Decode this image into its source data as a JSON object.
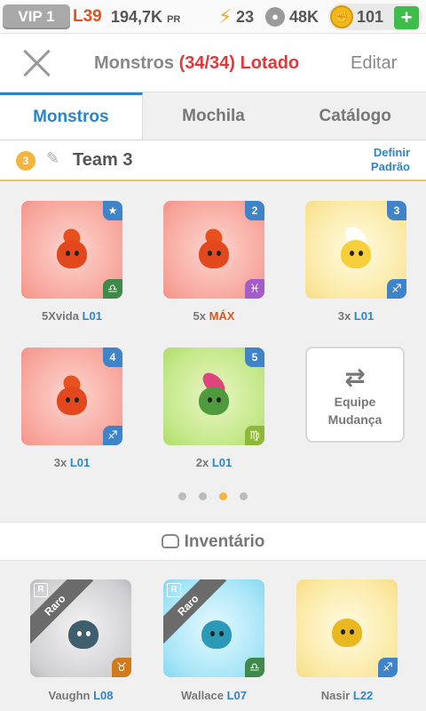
{
  "status": {
    "vip": "VIP 1",
    "level": "L39",
    "pr_value": "194,7K",
    "pr_unit": "PR",
    "energy": "23",
    "food": "48K",
    "coins": "101",
    "plus": "+"
  },
  "header": {
    "title_prefix": "Monstros",
    "title_count": "(34/34) Lotado",
    "edit": "Editar"
  },
  "tabs": [
    {
      "label": "Monstros"
    },
    {
      "label": "Mochila"
    },
    {
      "label": "Catálogo"
    }
  ],
  "team": {
    "number": "3",
    "name": "Team 3",
    "define_line1": "Definir",
    "define_line2": "Padrão"
  },
  "team_monsters": [
    {
      "corner": "★",
      "sign": "♎",
      "count": "5Xvida",
      "level": "L01"
    },
    {
      "corner": "2",
      "sign": "♓",
      "count": "5x",
      "level": "MÁX"
    },
    {
      "corner": "3",
      "sign": "♐",
      "count": "3x",
      "level": "L01"
    },
    {
      "corner": "4",
      "sign": "♐",
      "count": "3x",
      "level": "L01"
    },
    {
      "corner": "5",
      "sign": "♍",
      "count": "2x",
      "level": "L01"
    }
  ],
  "swap": {
    "icon": "⇄",
    "line1": "Equipe",
    "line2": "Mudança"
  },
  "pager": {
    "pages": 4,
    "active": 3
  },
  "inventory": {
    "title": "Inventário",
    "items": [
      {
        "name": "Vaughn",
        "level": "L08",
        "ribbon": "Raro",
        "badge": "R",
        "sign": "♉"
      },
      {
        "name": "Wallace",
        "level": "L07",
        "ribbon": "Raro",
        "badge": "R",
        "sign": "♎"
      },
      {
        "name": "Nasir",
        "level": "L22",
        "ribbon": "",
        "badge": "",
        "sign": "♐"
      }
    ]
  },
  "colors": {
    "accent_blue": "#2d85c9",
    "alert_red": "#e0383b",
    "gold": "#f3b53c",
    "green_plus": "#3ebd4a"
  }
}
